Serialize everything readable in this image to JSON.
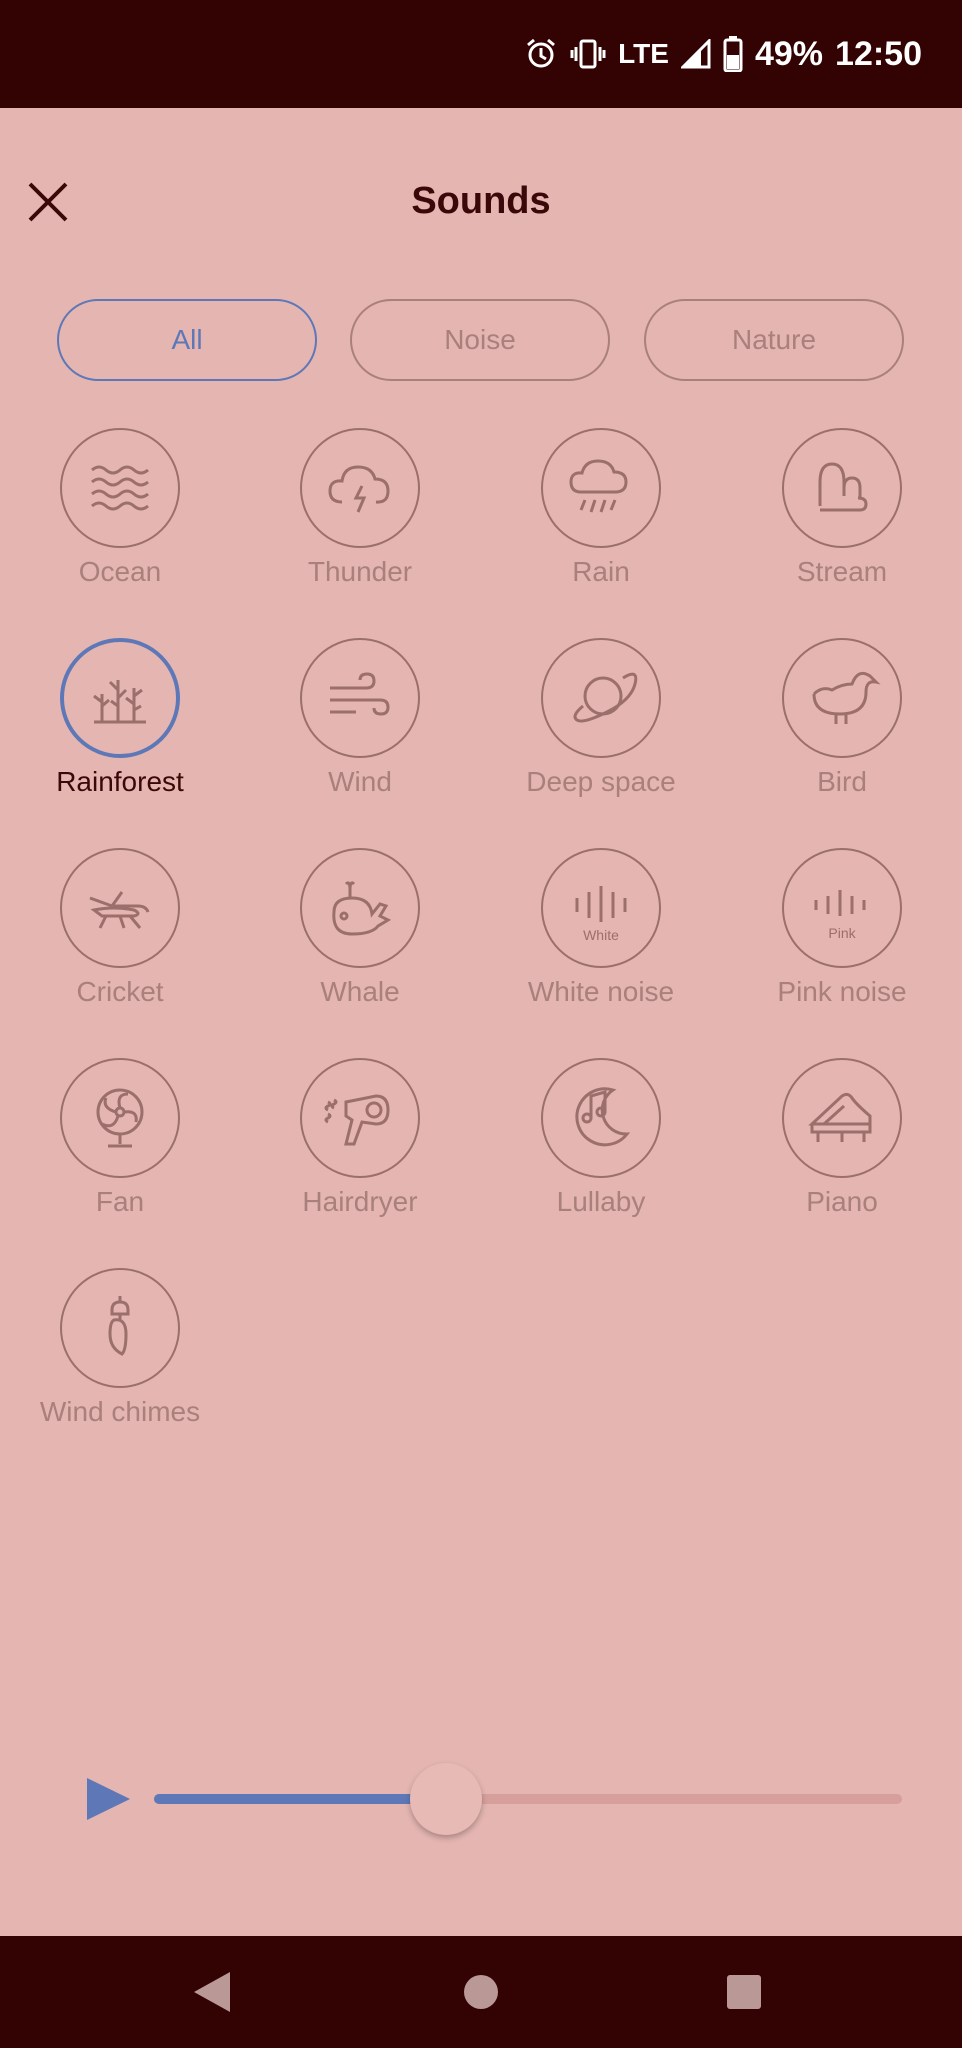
{
  "status_bar": {
    "network": "LTE",
    "battery": "49%",
    "time": "12:50",
    "icons": [
      "alarm-icon",
      "vibrate-icon",
      "signal-icon",
      "battery-icon"
    ]
  },
  "header": {
    "title": "Sounds",
    "close_icon": "close-icon"
  },
  "filters": [
    {
      "label": "All",
      "active": true
    },
    {
      "label": "Noise",
      "active": false
    },
    {
      "label": "Nature",
      "active": false
    }
  ],
  "sounds": [
    {
      "label": "Ocean",
      "icon": "waves-icon"
    },
    {
      "label": "Thunder",
      "icon": "thunder-cloud-icon"
    },
    {
      "label": "Rain",
      "icon": "rain-cloud-icon"
    },
    {
      "label": "Stream",
      "icon": "stream-icon"
    },
    {
      "label": "Rainforest",
      "icon": "trees-icon",
      "selected": true
    },
    {
      "label": "Wind",
      "icon": "wind-icon"
    },
    {
      "label": "Deep space",
      "icon": "planet-icon"
    },
    {
      "label": "Bird",
      "icon": "bird-icon"
    },
    {
      "label": "Cricket",
      "icon": "cricket-icon"
    },
    {
      "label": "Whale",
      "icon": "whale-icon"
    },
    {
      "label": "White noise",
      "icon": "white-noise-icon",
      "icon_text": "White"
    },
    {
      "label": "Pink noise",
      "icon": "pink-noise-icon",
      "icon_text": "Pink"
    },
    {
      "label": "Fan",
      "icon": "fan-icon"
    },
    {
      "label": "Hairdryer",
      "icon": "hairdryer-icon"
    },
    {
      "label": "Lullaby",
      "icon": "lullaby-icon"
    },
    {
      "label": "Piano",
      "icon": "piano-icon"
    },
    {
      "label": "Wind chimes",
      "icon": "wind-chimes-icon"
    }
  ],
  "player": {
    "play_icon": "play-icon",
    "volume_fraction": 0.39
  },
  "nav_bar": {
    "buttons": [
      "back-icon",
      "home-icon",
      "recents-icon"
    ]
  },
  "colors": {
    "background": "#e4b5b1",
    "bars": "#330303",
    "accent": "#5e78b7",
    "muted": "#a9807c",
    "title": "#3a0808"
  }
}
